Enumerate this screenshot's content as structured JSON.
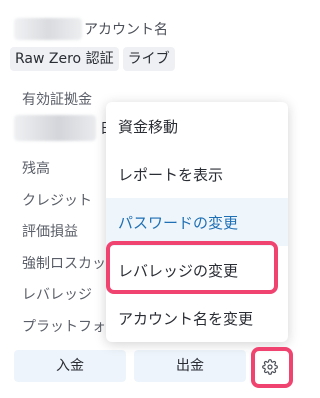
{
  "account": {
    "name_suffix": "アカウント名",
    "badges": [
      "Raw Zero 認証",
      "ライブ"
    ]
  },
  "cert": {
    "label": "有効証拠金",
    "value_tail": "日"
  },
  "rows": [
    "残高",
    "クレジット",
    "評価損益",
    "強制ロスカッ",
    "レバレッジ",
    "プラットフォ"
  ],
  "buttons": {
    "deposit": "入金",
    "withdraw": "出金"
  },
  "menu": {
    "items": [
      "資金移動",
      "レポートを表示",
      "パスワードの変更",
      "レバレッジの変更",
      "アカウント名を変更"
    ]
  },
  "icons": {
    "settings": "gear-icon"
  },
  "colors": {
    "highlight": "#f0436f",
    "menu_active_bg": "#eef6fc",
    "menu_active_text": "#1f6fb4",
    "button_bg": "#edf4fb"
  }
}
